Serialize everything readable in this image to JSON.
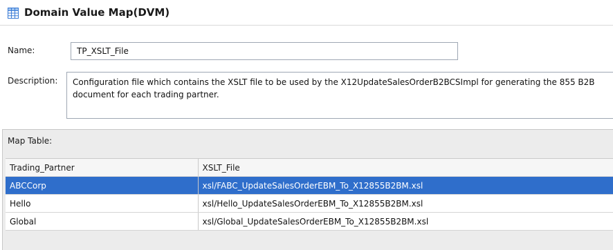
{
  "header": {
    "title": "Domain Value Map(DVM)",
    "icon": "table-grid-icon"
  },
  "form": {
    "name_label": "Name:",
    "name_value": "TP_XSLT_File",
    "description_label": "Description:",
    "description_value": "Configuration file which contains the XSLT file to be used by the X12UpdateSalesOrderB2BCSImpl for generating the 855 B2B document for each trading partner."
  },
  "map_table": {
    "label": "Map Table:",
    "columns": [
      "Trading_Partner",
      "XSLT_File"
    ],
    "rows": [
      {
        "trading_partner": "ABCCorp",
        "xslt_file": "xsl/FABC_UpdateSalesOrderEBM_To_X12855B2BM.xsl",
        "selected": true
      },
      {
        "trading_partner": "Hello",
        "xslt_file": "xsl/Hello_UpdateSalesOrderEBM_To_X12855B2BM.xsl",
        "selected": false
      },
      {
        "trading_partner": "Global",
        "xslt_file": "xsl/Global_UpdateSalesOrderEBM_To_X12855B2BM.xsl",
        "selected": false
      }
    ]
  },
  "colors": {
    "selection": "#2f6ecb",
    "panel_background": "#ececec",
    "icon_accent": "#3a7bd5"
  }
}
